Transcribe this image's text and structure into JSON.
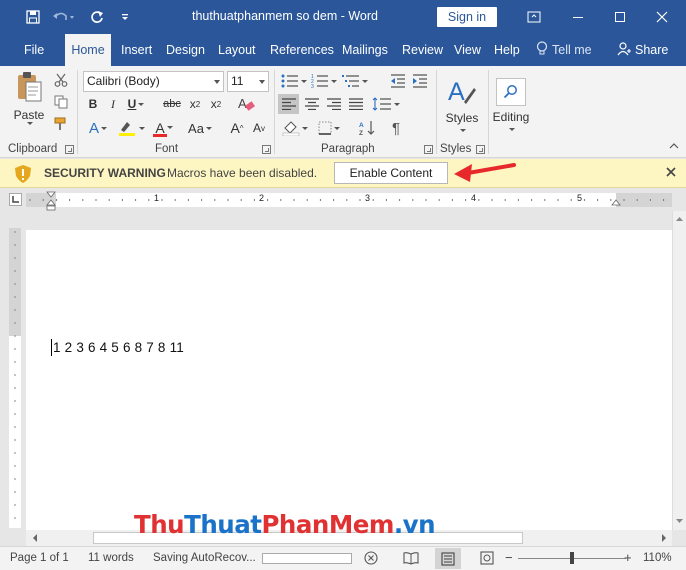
{
  "titlebar": {
    "title": "thuthuatphanmem so dem  -  Word",
    "sign_in": "Sign in",
    "quick_access": [
      "save-icon",
      "undo-icon",
      "redo-icon",
      "customize-icon"
    ],
    "window_controls": [
      "ribbon-display-icon",
      "minimize-icon",
      "maximize-icon",
      "close-icon"
    ]
  },
  "tabs": [
    {
      "label": "File"
    },
    {
      "label": "Home",
      "active": true
    },
    {
      "label": "Insert"
    },
    {
      "label": "Design"
    },
    {
      "label": "Layout"
    },
    {
      "label": "References"
    },
    {
      "label": "Mailings"
    },
    {
      "label": "Review"
    },
    {
      "label": "View"
    },
    {
      "label": "Help"
    }
  ],
  "tell_me": "Tell me",
  "share": "Share",
  "ribbon": {
    "clipboard": {
      "label": "Clipboard",
      "paste": "Paste"
    },
    "font": {
      "label": "Font",
      "font_name": "Calibri (Body)",
      "font_size": "11",
      "bold": "B",
      "italic": "I",
      "underline": "U",
      "strikethrough": "abc",
      "subscript": "x",
      "superscript": "x",
      "grow": "A",
      "shrink": "A",
      "change_case": "Aa",
      "font_color": "A",
      "text_effects": "A"
    },
    "paragraph": {
      "label": "Paragraph"
    },
    "styles": {
      "label": "Styles",
      "button": "Styles"
    },
    "editing": {
      "button": "Editing"
    }
  },
  "security": {
    "title": "SECURITY WARNING",
    "message": "Macros have been disabled.",
    "button": "Enable Content"
  },
  "ruler": {
    "numbers": [
      "1",
      "2",
      "3",
      "4",
      "5"
    ]
  },
  "document": {
    "text": "1 2 3 6 4 5 6 8 7 8 11"
  },
  "watermark": {
    "part1": "Thu",
    "part2": "Thuat",
    "part3": "PhanMem",
    "part4": ".vn"
  },
  "status": {
    "page": "Page 1 of 1",
    "words": "11 words",
    "saving": "Saving AutoRecov...",
    "zoom": "110%"
  },
  "colors": {
    "title_bar": "#2b579a",
    "security_bar": "#fdf6c3",
    "arrow": "#e8292b",
    "watermark_red": "#e03232",
    "watermark_blue": "#1a73c8"
  }
}
